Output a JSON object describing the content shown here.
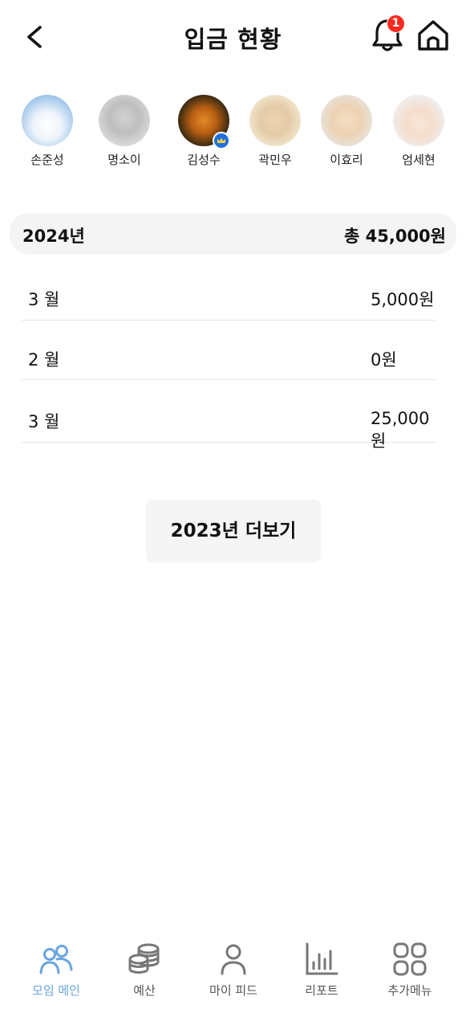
{
  "header": {
    "title": "입금 현황",
    "notification_count": "1"
  },
  "members": [
    {
      "name": "손준성",
      "icon": "cat-white-avatar",
      "faded": false,
      "crown": false
    },
    {
      "name": "명소이",
      "icon": "cat-gray-avatar",
      "faded": true,
      "crown": false
    },
    {
      "name": "김성수",
      "icon": "tiger-avatar",
      "faded": false,
      "crown": true
    },
    {
      "name": "곽민우",
      "icon": "lion-avatar",
      "faded": true,
      "crown": false
    },
    {
      "name": "이효리",
      "icon": "dog-avatar",
      "faded": true,
      "crown": false
    },
    {
      "name": "엄세현",
      "icon": "hamster-avatar",
      "faded": true,
      "crown": false
    }
  ],
  "summary": {
    "year": "2024년",
    "total": "총 45,000원"
  },
  "rows": [
    {
      "month": "3 월",
      "amount": "5,000원"
    },
    {
      "month": "2 월",
      "amount": "0원"
    },
    {
      "month": "3 월",
      "amount": "25,000원"
    }
  ],
  "more_button": "2023년 더보기",
  "tabs": [
    {
      "label": "모임 메인",
      "icon": "people-icon",
      "active": true
    },
    {
      "label": "예산",
      "icon": "coins-icon",
      "active": false
    },
    {
      "label": "마이 피드",
      "icon": "person-icon",
      "active": false
    },
    {
      "label": "리포트",
      "icon": "bar-chart-icon",
      "active": false
    },
    {
      "label": "추가메뉴",
      "icon": "grid-icon",
      "active": false
    }
  ],
  "colors": {
    "accent": "#6aa5df",
    "badge": "#ff2a1f",
    "crown": "#1f6fe0"
  }
}
